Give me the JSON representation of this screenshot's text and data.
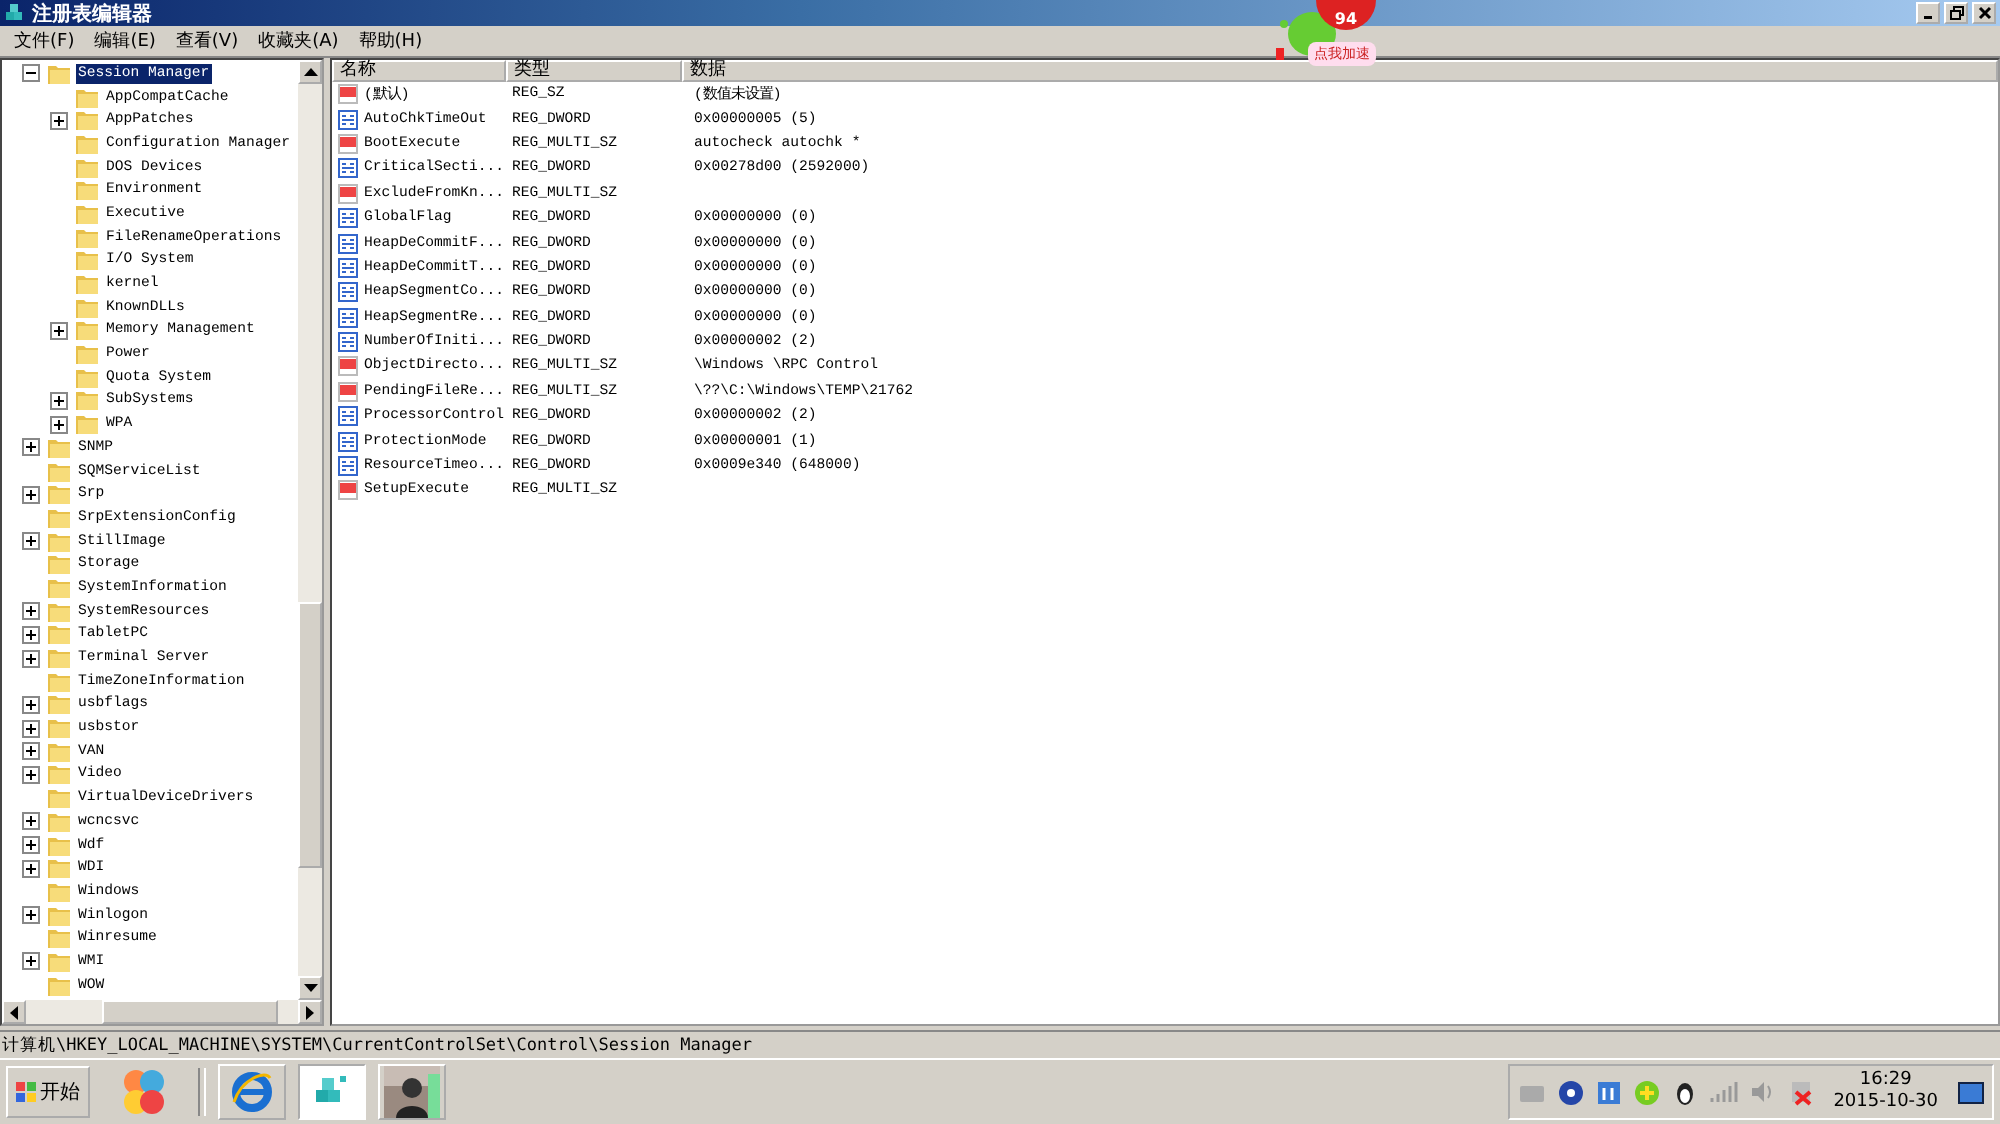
{
  "window": {
    "title": "注册表编辑器"
  },
  "menu": [
    "文件(F)",
    "编辑(E)",
    "查看(V)",
    "收藏夹(A)",
    "帮助(H)"
  ],
  "tree": [
    {
      "label": "Session Manager",
      "selected": true,
      "kind": "branch",
      "expanded": true,
      "children": [
        {
          "label": "AppCompatCache",
          "selected": false,
          "kind": "leaf"
        },
        {
          "label": "AppPatches",
          "selected": false,
          "kind": "branch",
          "expanded": false
        },
        {
          "label": "Configuration Manager",
          "selected": false,
          "kind": "leaf"
        },
        {
          "label": "DOS Devices",
          "selected": false,
          "kind": "leaf"
        },
        {
          "label": "Environment",
          "selected": false,
          "kind": "leaf"
        },
        {
          "label": "Executive",
          "selected": false,
          "kind": "leaf"
        },
        {
          "label": "FileRenameOperations",
          "selected": false,
          "kind": "leaf"
        },
        {
          "label": "I/O System",
          "selected": false,
          "kind": "leaf"
        },
        {
          "label": "kernel",
          "selected": false,
          "kind": "leaf"
        },
        {
          "label": "KnownDLLs",
          "selected": false,
          "kind": "leaf"
        },
        {
          "label": "Memory Management",
          "selected": false,
          "kind": "branch",
          "expanded": false
        },
        {
          "label": "Power",
          "selected": false,
          "kind": "leaf"
        },
        {
          "label": "Quota System",
          "selected": false,
          "kind": "leaf"
        },
        {
          "label": "SubSystems",
          "selected": false,
          "kind": "branch",
          "expanded": false
        },
        {
          "label": "WPA",
          "selected": false,
          "kind": "branch",
          "expanded": false
        }
      ]
    },
    {
      "label": "SNMP",
      "selected": false,
      "kind": "branch",
      "expanded": false
    },
    {
      "label": "SQMServiceList",
      "selected": false,
      "kind": "leaf"
    },
    {
      "label": "Srp",
      "selected": false,
      "kind": "branch",
      "expanded": false
    },
    {
      "label": "SrpExtensionConfig",
      "selected": false,
      "kind": "leaf"
    },
    {
      "label": "StillImage",
      "selected": false,
      "kind": "branch",
      "expanded": false
    },
    {
      "label": "Storage",
      "selected": false,
      "kind": "leaf"
    },
    {
      "label": "SystemInformation",
      "selected": false,
      "kind": "leaf"
    },
    {
      "label": "SystemResources",
      "selected": false,
      "kind": "branch",
      "expanded": false
    },
    {
      "label": "TabletPC",
      "selected": false,
      "kind": "branch",
      "expanded": false
    },
    {
      "label": "Terminal Server",
      "selected": false,
      "kind": "branch",
      "expanded": false
    },
    {
      "label": "TimeZoneInformation",
      "selected": false,
      "kind": "leaf"
    },
    {
      "label": "usbflags",
      "selected": false,
      "kind": "branch",
      "expanded": false
    },
    {
      "label": "usbstor",
      "selected": false,
      "kind": "branch",
      "expanded": false
    },
    {
      "label": "VAN",
      "selected": false,
      "kind": "branch",
      "expanded": false
    },
    {
      "label": "Video",
      "selected": false,
      "kind": "branch",
      "expanded": false
    },
    {
      "label": "VirtualDeviceDrivers",
      "selected": false,
      "kind": "leaf"
    },
    {
      "label": "wcncsvc",
      "selected": false,
      "kind": "branch",
      "expanded": false
    },
    {
      "label": "Wdf",
      "selected": false,
      "kind": "branch",
      "expanded": false
    },
    {
      "label": "WDI",
      "selected": false,
      "kind": "branch",
      "expanded": false
    },
    {
      "label": "Windows",
      "selected": false,
      "kind": "leaf"
    },
    {
      "label": "Winlogon",
      "selected": false,
      "kind": "branch",
      "expanded": false
    },
    {
      "label": "Winresume",
      "selected": false,
      "kind": "leaf"
    },
    {
      "label": "WMI",
      "selected": false,
      "kind": "branch",
      "expanded": false
    },
    {
      "label": "WOW",
      "selected": false,
      "kind": "leaf"
    }
  ],
  "table": {
    "columns": [
      "名称",
      "类型",
      "数据"
    ],
    "rows": [
      {
        "kind": "string",
        "name": "(默认)",
        "type": "REG_SZ",
        "data": "(数值未设置)"
      },
      {
        "kind": "number",
        "name": "AutoChkTimeOut",
        "type": "REG_DWORD",
        "data": "0x00000005 (5)"
      },
      {
        "kind": "string",
        "name": "BootExecute",
        "type": "REG_MULTI_SZ",
        "data": "autocheck autochk *"
      },
      {
        "kind": "number",
        "name": "CriticalSecti...",
        "type": "REG_DWORD",
        "data": "0x00278d00 (2592000)"
      },
      {
        "kind": "string",
        "name": "ExcludeFromKn...",
        "type": "REG_MULTI_SZ"
      },
      {
        "kind": "number",
        "name": "GlobalFlag",
        "type": "REG_DWORD",
        "data": "0x00000000 (0)"
      },
      {
        "kind": "number",
        "name": "HeapDeCommitF...",
        "type": "REG_DWORD",
        "data": "0x00000000 (0)"
      },
      {
        "kind": "number",
        "name": "HeapDeCommitT...",
        "type": "REG_DWORD",
        "data": "0x00000000 (0)"
      },
      {
        "kind": "number",
        "name": "HeapSegmentCo...",
        "type": "REG_DWORD",
        "data": "0x00000000 (0)"
      },
      {
        "kind": "number",
        "name": "HeapSegmentRe...",
        "type": "REG_DWORD",
        "data": "0x00000000 (0)"
      },
      {
        "kind": "number",
        "name": "NumberOfIniti...",
        "type": "REG_DWORD",
        "data": "0x00000002 (2)"
      },
      {
        "kind": "string",
        "name": "ObjectDirecto...",
        "type": "REG_MULTI_SZ",
        "data": "\\Windows \\RPC Control"
      },
      {
        "kind": "string",
        "name": "PendingFileRe...",
        "type": "REG_MULTI_SZ",
        "data": "\\??\\C:\\Windows\\TEMP\\21762"
      },
      {
        "kind": "number",
        "name": "ProcessorControl",
        "type": "REG_DWORD",
        "data": "0x00000002 (2)"
      },
      {
        "kind": "number",
        "name": "ProtectionMode",
        "type": "REG_DWORD",
        "data": "0x00000001 (1)"
      },
      {
        "kind": "number",
        "name": "ResourceTimeo...",
        "type": "REG_DWORD",
        "data": "0x0009e340 (648000)"
      },
      {
        "kind": "string",
        "name": "SetupExecute",
        "type": "REG_MULTI_SZ"
      }
    ]
  },
  "status_bar": "计算机\\HKEY_LOCAL_MACHINE\\SYSTEM\\CurrentControlSet\\Control\\Session Manager",
  "overlay": {
    "count": "94",
    "label": "点我加速"
  },
  "taskbar": {
    "start": "开始",
    "time": "16:29",
    "date": "2015-10-30"
  }
}
